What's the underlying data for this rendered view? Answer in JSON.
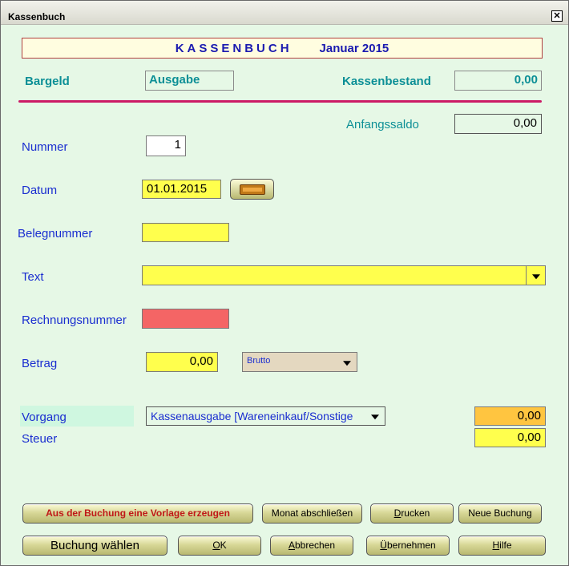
{
  "window": {
    "title": "Kassenbuch",
    "close_symbol": "✕"
  },
  "header": {
    "spaced_title": "KASSENBUCH",
    "month": "Januar  2015"
  },
  "status": {
    "cash_label": "Bargeld",
    "type_value": "Ausgabe",
    "balance_label": "Kassenbestand",
    "balance_value": "0,00",
    "opening_label": "Anfangssaldo",
    "opening_value": "0,00"
  },
  "form": {
    "nummer_label": "Nummer",
    "nummer_value": "1",
    "datum_label": "Datum",
    "datum_value": "01.01.2015",
    "beleg_label": "Belegnummer",
    "beleg_value": "",
    "text_label": "Text",
    "text_value": "",
    "rechnung_label": "Rechnungsnummer",
    "rechnung_value": "",
    "betrag_label": "Betrag",
    "betrag_value": "0,00",
    "brutto_value": "Brutto",
    "vorgang_label": "Vorgang",
    "vorgang_value": "Kassenausgabe [Wareneinkauf/Sonstige",
    "vorgang_amount": "0,00",
    "steuer_label": "Steuer",
    "steuer_amount": "0,00"
  },
  "buttons": {
    "vorlage": "Aus der Buchung eine Vorlage erzeugen",
    "monat": "Monat abschließen",
    "drucken_ul": "D",
    "drucken_rest": "rucken",
    "neue": "Neue Buchung",
    "wahlen": "Buchung wählen",
    "ok_ul": "O",
    "ok_rest": "K",
    "abbrechen_ul": "A",
    "abbrechen_rest": "bbrechen",
    "ubernehmen_ul": "Ü",
    "ubernehmen_rest": "bernehmen",
    "hilfe_ul": "H",
    "hilfe_rest": "ilfe"
  },
  "icons": {
    "calendar": "calendar-icon",
    "close": "close-icon",
    "dropdown": "chevron-down-icon"
  },
  "colors": {
    "background": "#e6f8e6",
    "teal": "#0c8f96",
    "blue": "#1a2ed0",
    "header_blue": "#1a1ab0",
    "accent_line": "#cc1a66",
    "yellow_field": "#ffff4d",
    "red_field": "#f46565",
    "orange_field": "#ffc540"
  }
}
